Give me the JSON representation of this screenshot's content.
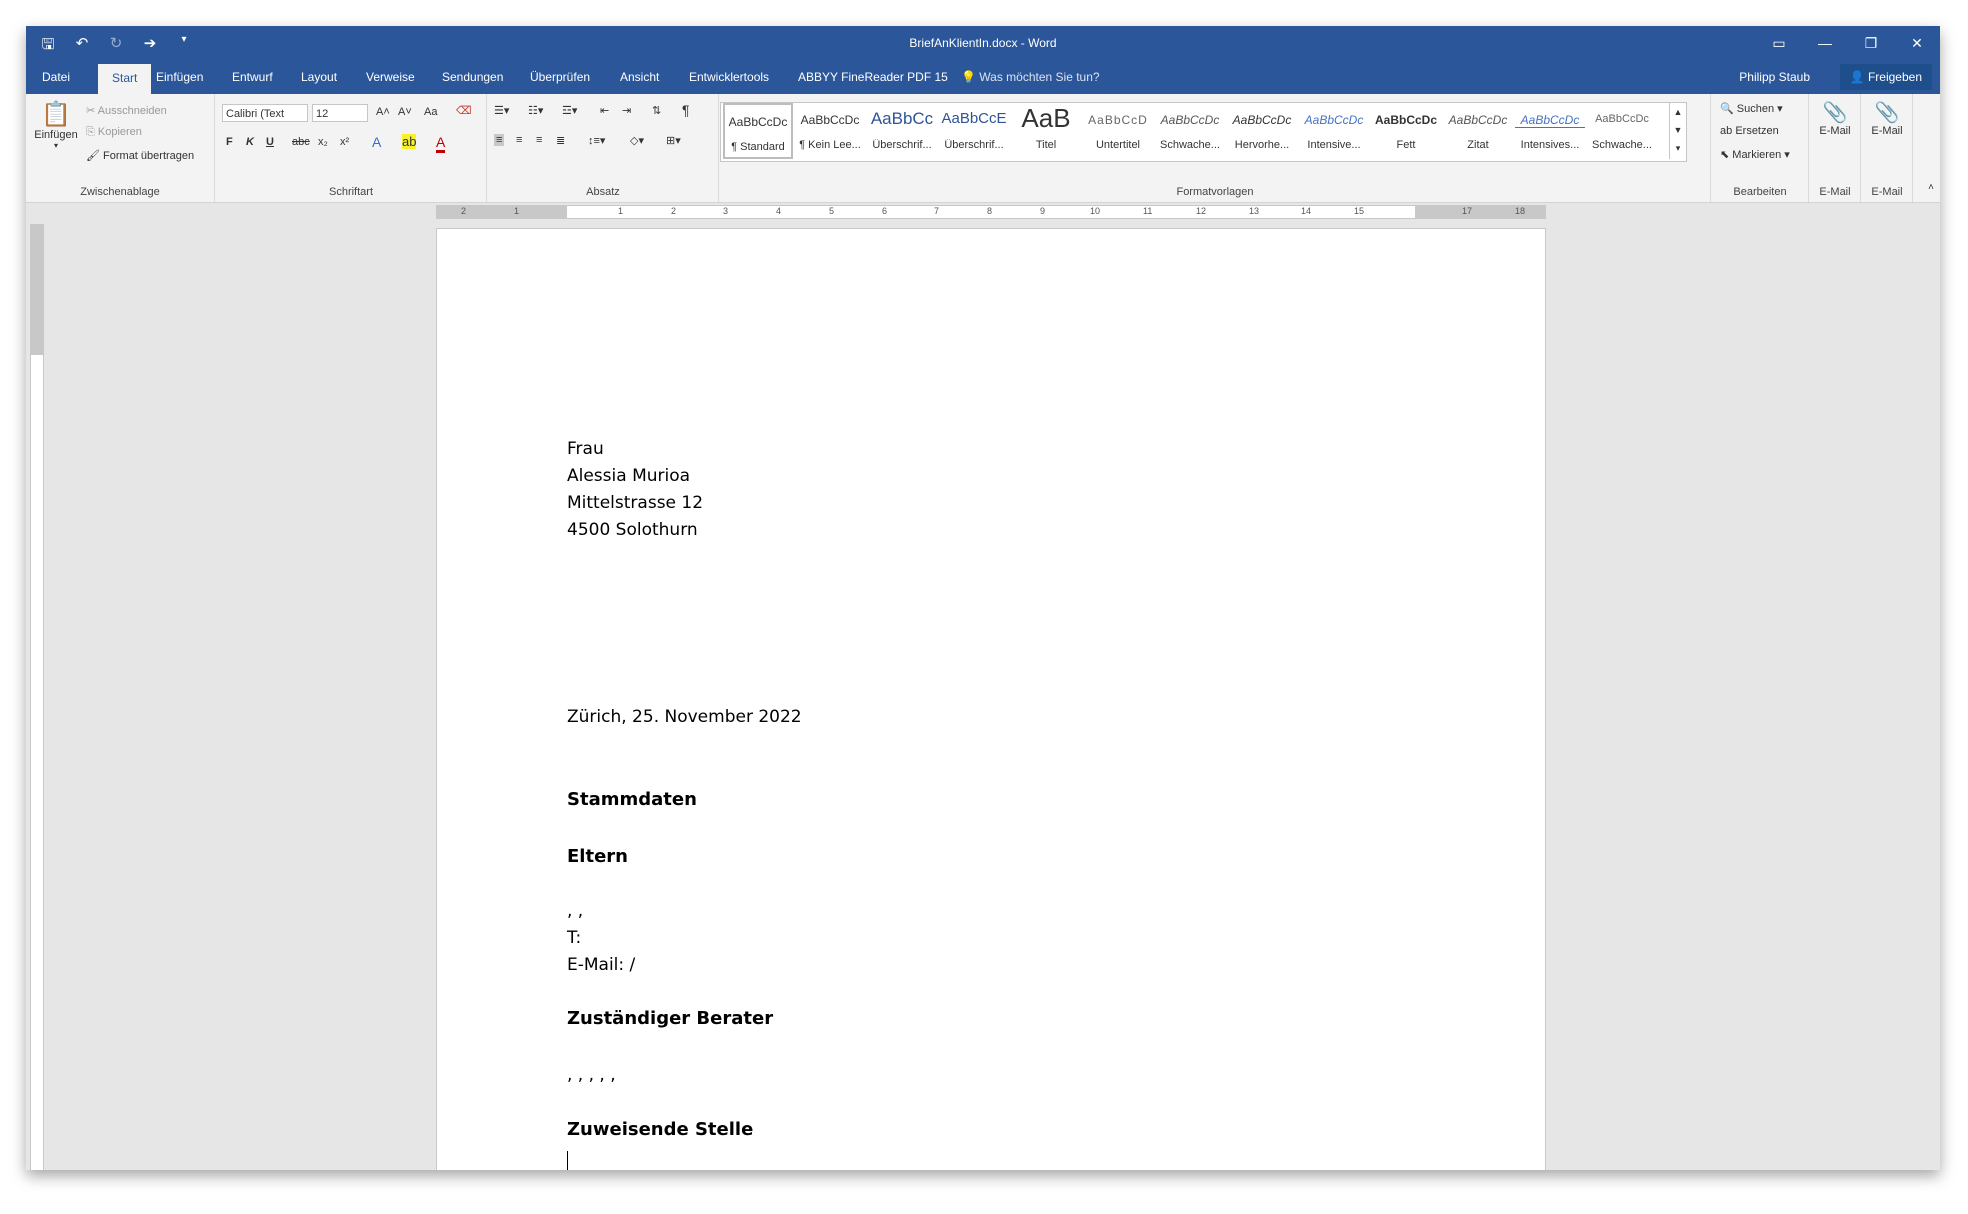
{
  "window": {
    "title": "BriefAnKlientIn.docx - Word",
    "qat": [
      "save-icon",
      "undo-icon",
      "redo-icon",
      "repeat-icon",
      "customize-icon"
    ],
    "controls": {
      "ribbon_options": "▭",
      "minimize": "—",
      "restore": "❐",
      "close": "✕"
    }
  },
  "tabs": [
    "Datei",
    "Start",
    "Einfügen",
    "Entwurf",
    "Layout",
    "Verweise",
    "Sendungen",
    "Überprüfen",
    "Ansicht",
    "Entwicklertools",
    "ABBYY FineReader PDF 15"
  ],
  "active_tab": "Start",
  "tell_me": "Was möchten Sie tun?",
  "user": "Philipp Staub",
  "share": "Freigeben",
  "clipboard": {
    "paste": "Einfügen",
    "cut": "Ausschneiden",
    "copy": "Kopieren",
    "format_painter": "Format übertragen",
    "label": "Zwischenablage"
  },
  "font": {
    "name": "Calibri (Text",
    "size": "12",
    "label": "Schriftart",
    "bold": "F",
    "italic": "K",
    "underline": "U",
    "strike": "abc",
    "sub": "x₂",
    "sup": "x²",
    "aa": "Aa"
  },
  "paragraph": {
    "label": "Absatz",
    "pilcrow": "¶"
  },
  "styles": {
    "label": "Formatvorlagen",
    "items": [
      {
        "preview": "AaBbCcDc",
        "name": "¶ Standard"
      },
      {
        "preview": "AaBbCcDc",
        "name": "¶ Kein Lee..."
      },
      {
        "preview": "AaBbCc",
        "name": "Überschrif..."
      },
      {
        "preview": "AaBbCcE",
        "name": "Überschrif..."
      },
      {
        "preview": "AaB",
        "name": "Titel"
      },
      {
        "preview": "AaBbCcD",
        "name": "Untertitel"
      },
      {
        "preview": "AaBbCcDc",
        "name": "Schwache..."
      },
      {
        "preview": "AaBbCcDc",
        "name": "Hervorhe..."
      },
      {
        "preview": "AaBbCcDc",
        "name": "Intensive..."
      },
      {
        "preview": "AaBbCcDc",
        "name": "Fett"
      },
      {
        "preview": "AaBbCcDc",
        "name": "Zitat"
      },
      {
        "preview": "AaBbCcDc",
        "name": "Intensives..."
      },
      {
        "preview": "AaBbCcDc",
        "name": "Schwache..."
      }
    ]
  },
  "editing": {
    "label": "Bearbeiten",
    "find": "Suchen",
    "replace": "Ersetzen",
    "select": "Markieren"
  },
  "email1": {
    "btn": "E-Mail",
    "label": "E-Mail"
  },
  "email2": {
    "btn": "E-Mail",
    "label": "E-Mail"
  },
  "ruler": {
    "labels": [
      "2",
      "1",
      "1",
      "2",
      "3",
      "4",
      "5",
      "6",
      "7",
      "8",
      "9",
      "10",
      "11",
      "12",
      "13",
      "14",
      "15",
      "17",
      "18"
    ]
  },
  "document": {
    "address": [
      "Frau",
      "Alessia Murioa",
      "Mittelstrasse 12",
      "4500 Solothurn"
    ],
    "date": "Zürich, 25. November 2022",
    "h_stammdaten": "Stammdaten",
    "h_eltern": "Eltern",
    "eltern_line1": " , ,",
    "eltern_tel": "T:",
    "eltern_mail": "E-Mail:  /",
    "h_berater": "Zuständiger Berater",
    "berater_line": ", , , , ,",
    "h_stelle": "Zuweisende Stelle"
  }
}
